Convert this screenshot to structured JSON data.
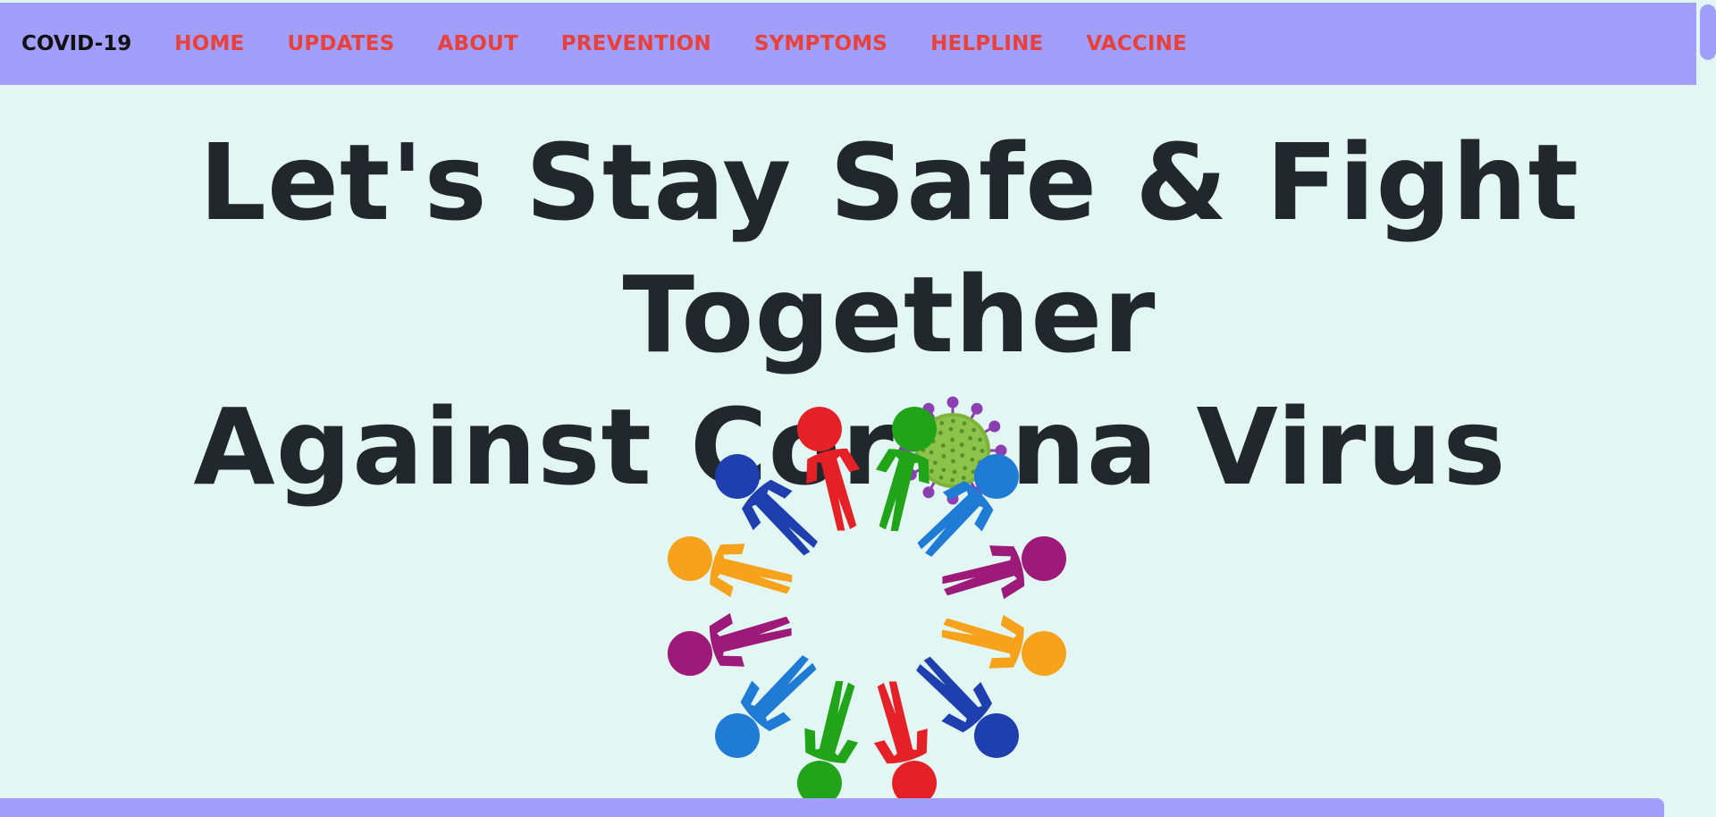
{
  "navbar": {
    "brand": "COVID-19",
    "links": [
      {
        "label": "HOME"
      },
      {
        "label": "UPDATES"
      },
      {
        "label": "ABOUT"
      },
      {
        "label": "PREVENTION"
      },
      {
        "label": "SYMPTOMS"
      },
      {
        "label": "HELPLINE"
      },
      {
        "label": "VACCINE"
      }
    ],
    "background_color": "#a29efc",
    "link_color": "#e8403a"
  },
  "hero": {
    "line1": "Let's Stay Safe & Fight Together",
    "line2_before_icon": "Against Cor",
    "line2_after_icon": "na Virus",
    "text_color": "#22272b",
    "icon": "coronavirus-icon"
  },
  "illustration": {
    "icon": "people-circle-unity-icon",
    "person_colors": [
      "#e52128",
      "#21a31a",
      "#1f7bd4",
      "#9e1a78",
      "#f7a21c",
      "#1f3fae"
    ]
  },
  "page": {
    "background_color": "#e2f7f4"
  }
}
